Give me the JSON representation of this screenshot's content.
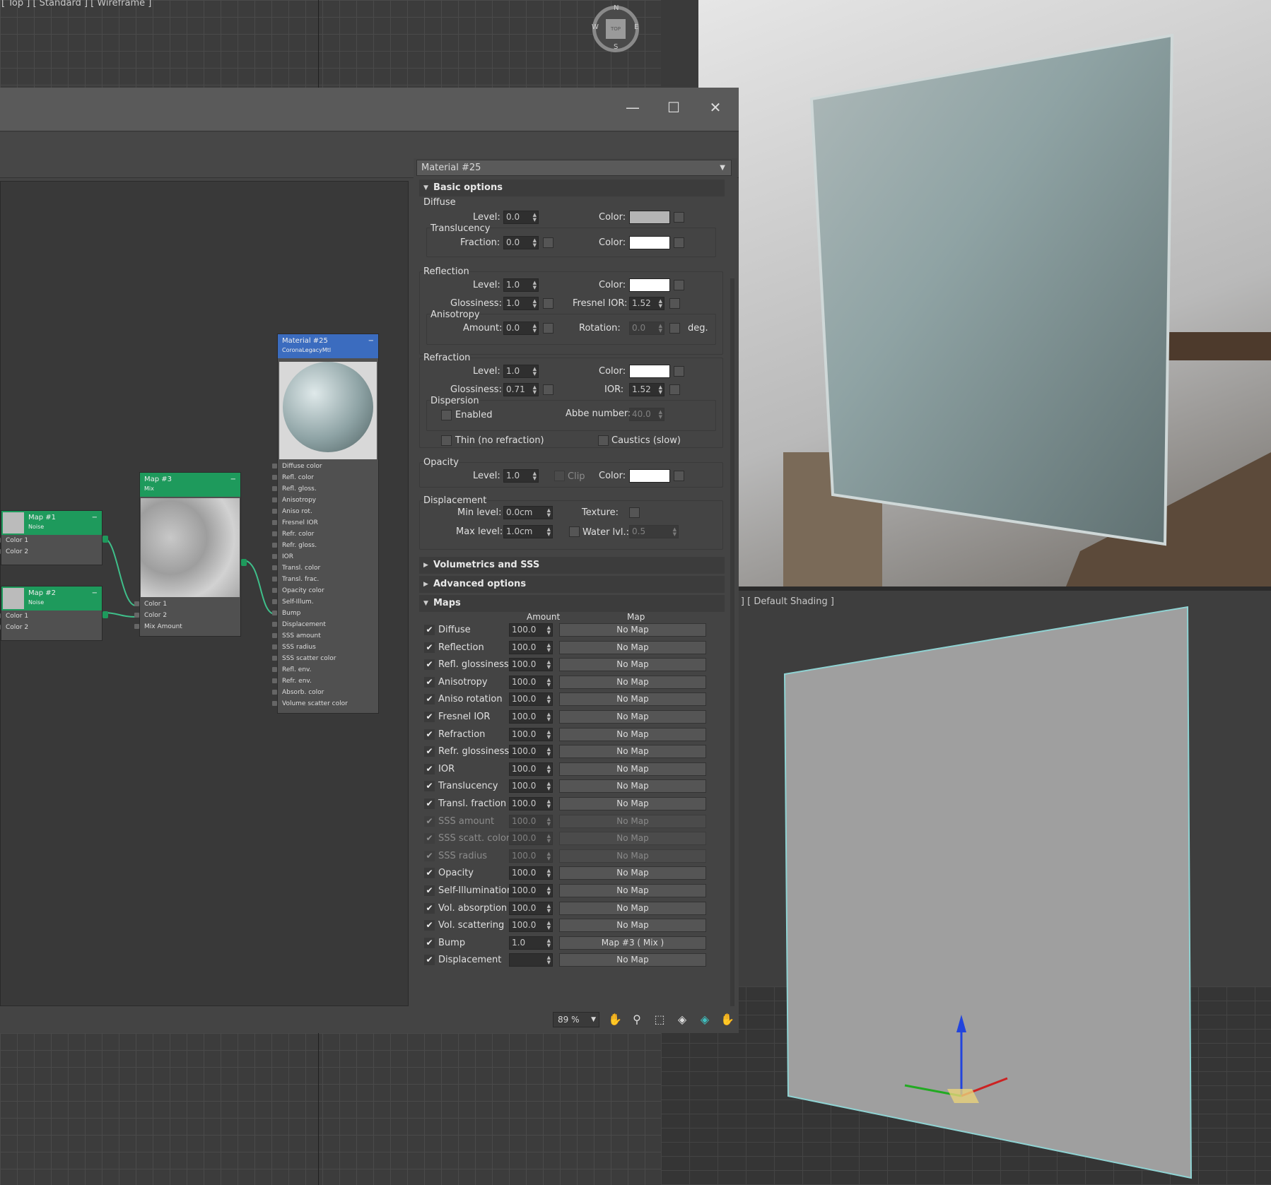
{
  "viewport_top": {
    "label": "[ Top ] [ Standard ] [ Wireframe ]"
  },
  "viewcube": {
    "n": "N",
    "s": "S",
    "e": "E",
    "w": "W",
    "face": "TOP"
  },
  "viewport_persp": {
    "label": "] [ Performance ] [ Default Shading ]"
  },
  "window": {
    "minimize": "—",
    "maximize": "☐",
    "close": "✕"
  },
  "nodes": {
    "material": {
      "title": "Material #25",
      "subtitle": "CoronaLegacyMtl",
      "minimize": "−",
      "slots": [
        "Diffuse color",
        "Refl. color",
        "Refl. gloss.",
        "Anisotropy",
        "Aniso rot.",
        "Fresnel IOR",
        "Refr. color",
        "Refr. gloss.",
        "IOR",
        "Transl. color",
        "Transl. frac.",
        "Opacity color",
        "Self-Illum.",
        "Bump",
        "Displacement",
        "SSS amount",
        "SSS radius",
        "SSS scatter color",
        "Refl. env.",
        "Refr. env.",
        "Absorb. color",
        "Volume scatter color"
      ]
    },
    "map3": {
      "title": "Map #3",
      "subtitle": "Mix",
      "minimize": "−",
      "slots": [
        "Color 1",
        "Color 2",
        "Mix Amount"
      ]
    },
    "map1": {
      "title": "Map #1",
      "subtitle": "Noise",
      "minimize": "−",
      "slots": [
        "Color 1",
        "Color 2"
      ]
    },
    "map2": {
      "title": "Map #2",
      "subtitle": "Noise",
      "minimize": "−",
      "slots": [
        "Color 1",
        "Color 2"
      ]
    }
  },
  "params": {
    "material_name": "Material #25",
    "basic_options": {
      "title": "Basic options",
      "diffuse": {
        "group": "Diffuse",
        "level_label": "Level:",
        "level": "0.0",
        "color_label": "Color:",
        "color": "#b4b4b4"
      },
      "translucency": {
        "group": "Translucency",
        "fraction_label": "Fraction:",
        "fraction": "0.0",
        "color_label": "Color:",
        "color": "#ffffff"
      },
      "reflection": {
        "group": "Reflection",
        "level_label": "Level:",
        "level": "1.0",
        "color_label": "Color:",
        "color": "#ffffff",
        "gloss_label": "Glossiness:",
        "gloss": "1.0",
        "fresnel_label": "Fresnel IOR:",
        "fresnel": "1.52"
      },
      "anisotropy": {
        "group": "Anisotropy",
        "amount_label": "Amount:",
        "amount": "0.0",
        "rotation_label": "Rotation:",
        "rotation": "0.0",
        "unit": "deg."
      },
      "refraction": {
        "group": "Refraction",
        "level_label": "Level:",
        "level": "1.0",
        "color_label": "Color:",
        "color": "#ffffff",
        "gloss_label": "Glossiness:",
        "gloss": "0.71",
        "ior_label": "IOR:",
        "ior": "1.52"
      },
      "dispersion": {
        "group": "Dispersion",
        "enabled_label": "Enabled",
        "abbe_label": "Abbe number:",
        "abbe": "40.0"
      },
      "thin_label": "Thin (no refraction)",
      "caustics_label": "Caustics (slow)",
      "opacity": {
        "group": "Opacity",
        "level_label": "Level:",
        "level": "1.0",
        "clip_label": "Clip",
        "color_label": "Color:",
        "color": "#ffffff"
      },
      "displacement": {
        "group": "Displacement",
        "min_label": "Min level:",
        "min": "0.0cm",
        "texture_label": "Texture:",
        "max_label": "Max level:",
        "max": "1.0cm",
        "water_label": "Water lvl.:",
        "water": "0.5"
      }
    },
    "volumetrics_title": "Volumetrics and SSS",
    "advanced_title": "Advanced options",
    "maps": {
      "title": "Maps",
      "amount_header": "Amount",
      "map_header": "Map",
      "rows": [
        {
          "name": "Diffuse",
          "amount": "100.0",
          "map": "No Map",
          "dim": false
        },
        {
          "name": "Reflection",
          "amount": "100.0",
          "map": "No Map",
          "dim": false
        },
        {
          "name": "Refl. glossiness",
          "amount": "100.0",
          "map": "No Map",
          "dim": false
        },
        {
          "name": "Anisotropy",
          "amount": "100.0",
          "map": "No Map",
          "dim": false
        },
        {
          "name": "Aniso rotation",
          "amount": "100.0",
          "map": "No Map",
          "dim": false
        },
        {
          "name": "Fresnel IOR",
          "amount": "100.0",
          "map": "No Map",
          "dim": false
        },
        {
          "name": "Refraction",
          "amount": "100.0",
          "map": "No Map",
          "dim": false
        },
        {
          "name": "Refr. glossiness",
          "amount": "100.0",
          "map": "No Map",
          "dim": false
        },
        {
          "name": "IOR",
          "amount": "100.0",
          "map": "No Map",
          "dim": false
        },
        {
          "name": "Translucency",
          "amount": "100.0",
          "map": "No Map",
          "dim": false
        },
        {
          "name": "Transl. fraction",
          "amount": "100.0",
          "map": "No Map",
          "dim": false
        },
        {
          "name": "SSS amount",
          "amount": "100.0",
          "map": "No Map",
          "dim": true
        },
        {
          "name": "SSS scatt. color",
          "amount": "100.0",
          "map": "No Map",
          "dim": true
        },
        {
          "name": "SSS radius",
          "amount": "100.0",
          "map": "No Map",
          "dim": true
        },
        {
          "name": "Opacity",
          "amount": "100.0",
          "map": "No Map",
          "dim": false
        },
        {
          "name": "Self-Illumination",
          "amount": "100.0",
          "map": "No Map",
          "dim": false
        },
        {
          "name": "Vol. absorption",
          "amount": "100.0",
          "map": "No Map",
          "dim": false
        },
        {
          "name": "Vol. scattering",
          "amount": "100.0",
          "map": "No Map",
          "dim": false
        },
        {
          "name": "Bump",
          "amount": "1.0",
          "map": "Map #3  ( Mix )",
          "dim": false
        },
        {
          "name": "Displacement",
          "amount": "",
          "map": "No Map",
          "dim": false
        }
      ]
    }
  },
  "status": {
    "zoom": "89 %",
    "dropdown": "▼"
  },
  "colors": {
    "node_header": "#1e9a5c",
    "material_header": "#3b6cbf",
    "wire": "#3fbf8a"
  }
}
